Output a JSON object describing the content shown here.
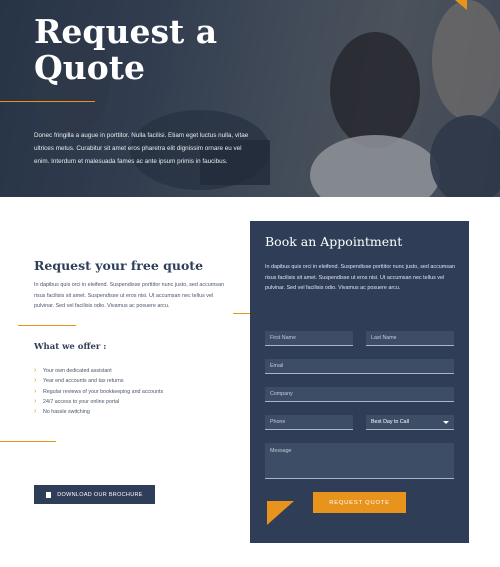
{
  "hero": {
    "title": "Request a\nQuote",
    "text": "Donec fringilla a augue in porttitor. Nulla facilisi. Etiam eget luctus nulla, vitae ultrices metus. Curabitur sit amet eros pharetra elit dignissim ornare eu vel enim. Interdum et malesuada fames ac ante ipsum primis in faucibus."
  },
  "left": {
    "title": "Request your free quote",
    "text": "In dapibus quis orci in eleifend. Suspendisse porttitor nunc justo, sed accumsan risus facilisis sit amet. Suspendisse ut eros nisi. Ut accumsan nec tellus vel pulvinar. Sed vel facilisis odio. Vivamus ac posuere arcu.",
    "offer_title": "What we offer :",
    "offers": [
      "Your own dedicated assistant",
      "Year end accounts and tax returns",
      "Regular reviews of your bookkeeping and accounts",
      "24/7 access to your online portal",
      "No hassle switching"
    ],
    "brochure_label": "DOWNLOAD OUR BROCHURE"
  },
  "form": {
    "title": "Book an Appointment",
    "text": "In dapibus quis orci in eleifend. Suspendisse porttitor nunc justo, sed accumsan risus facilisis sit amet. Suspendisse ut eros nisi. Ut accumsan nec tellus vel pulvinar. Sed vel facilisis odio. Vivamus ac posuere arcu.",
    "first_name": "First Name",
    "last_name": "Last Name",
    "email": "Email",
    "company": "Company",
    "phone": "Phone",
    "best_day": "Best Day to Call",
    "message": "Message",
    "submit_label": "REQUEST QUOTE"
  },
  "colors": {
    "accent": "#e8941c",
    "navy": "#2f3e56"
  }
}
